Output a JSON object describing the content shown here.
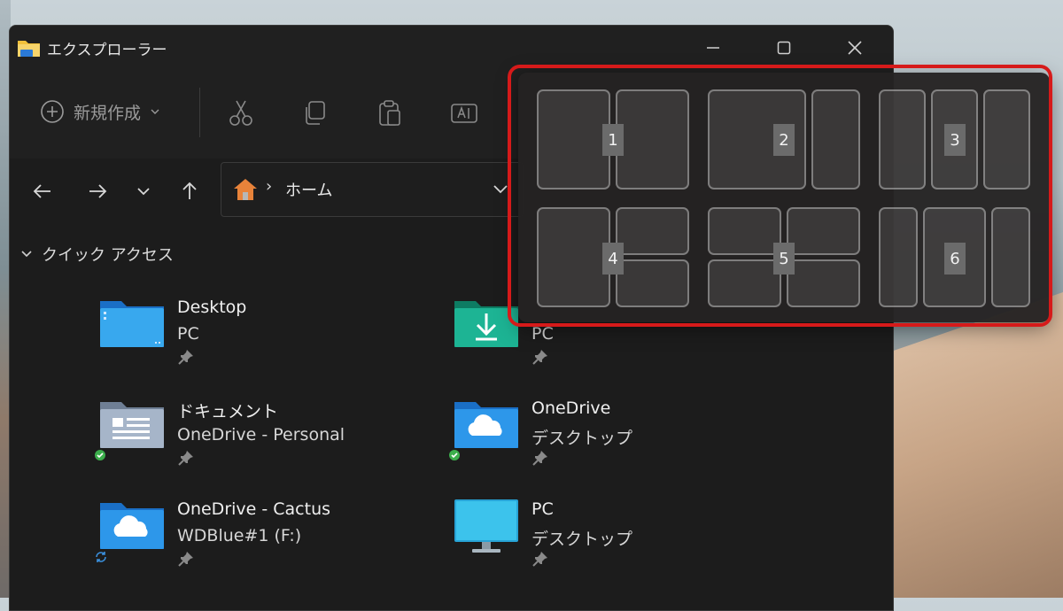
{
  "window": {
    "title": "エクスプローラー",
    "controls": {
      "minimize": "—",
      "maximize": "☐",
      "close": "✕"
    }
  },
  "toolbar": {
    "new_label": "新規作成",
    "items": [
      "cut-icon",
      "copy-icon",
      "paste-icon",
      "rename-icon"
    ]
  },
  "nav": {
    "address": "ホーム",
    "separator": "›"
  },
  "quick_access": {
    "header": "クイック アクセス",
    "items": [
      {
        "name": "Desktop",
        "sub": "PC",
        "icon": "desktop-folder-icon"
      },
      {
        "name": "",
        "sub": "PC",
        "icon": "downloads-folder-icon"
      },
      {
        "name": "ドキュメント",
        "sub": "OneDrive - Personal",
        "icon": "documents-folder-icon",
        "status": "synced"
      },
      {
        "name": "OneDrive",
        "sub": "デスクトップ",
        "icon": "onedrive-folder-icon",
        "status": "synced"
      },
      {
        "name": "OneDrive - Cactus",
        "sub": "WDBlue#1 (F:)",
        "icon": "onedrive-folder-icon",
        "status": "syncing"
      },
      {
        "name": "PC",
        "sub": "デスクトップ",
        "icon": "pc-monitor-icon"
      }
    ]
  },
  "snap_layouts": {
    "layouts": [
      {
        "label": "1"
      },
      {
        "label": "2"
      },
      {
        "label": "3"
      },
      {
        "label": "4"
      },
      {
        "label": "5"
      },
      {
        "label": "6"
      }
    ]
  },
  "colors": {
    "accent_outline": "#d61a1a",
    "folder_blue": "#2a8fe0",
    "folder_green": "#1aa38a",
    "sync_green": "#3cae4c"
  }
}
